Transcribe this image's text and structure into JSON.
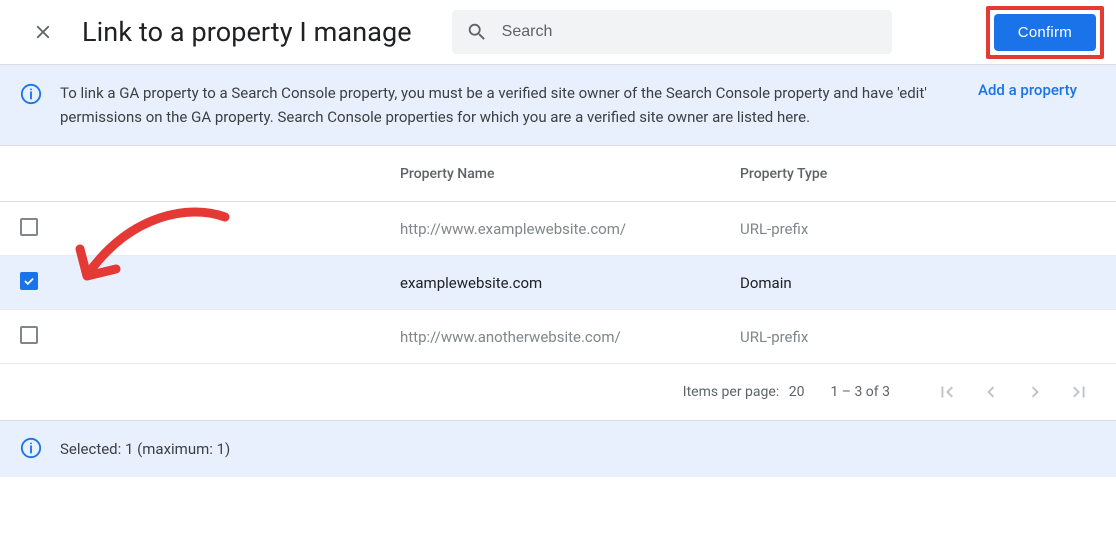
{
  "header": {
    "title": "Link to a property I manage",
    "search_placeholder": "Search",
    "confirm_label": "Confirm"
  },
  "info": {
    "text": "To link a GA property to a Search Console property, you must be a verified site owner of the Search Console property and have 'edit' permissions on the GA property. Search Console properties for which you are a verified site owner are listed here.",
    "add_link_label": "Add a property"
  },
  "table": {
    "columns": {
      "name": "Property Name",
      "type": "Property Type"
    },
    "rows": [
      {
        "checked": false,
        "name": "http://www.examplewebsite.com/",
        "type": "URL-prefix",
        "muted": true
      },
      {
        "checked": true,
        "name": "examplewebsite.com",
        "type": "Domain",
        "muted": false
      },
      {
        "checked": false,
        "name": "http://www.anotherwebsite.com/",
        "type": "URL-prefix",
        "muted": true
      }
    ]
  },
  "pager": {
    "items_per_page_label": "Items per page:",
    "items_per_page": "20",
    "range": "1 – 3 of 3"
  },
  "footer": {
    "selected_text": "Selected: 1 (maximum: 1)"
  },
  "annotations": {
    "confirm_highlight": true,
    "arrow_to_checkbox": true
  },
  "colors": {
    "primary": "#1a73e8",
    "info_bg": "#e8f0fe",
    "highlight_red": "#e53935"
  }
}
